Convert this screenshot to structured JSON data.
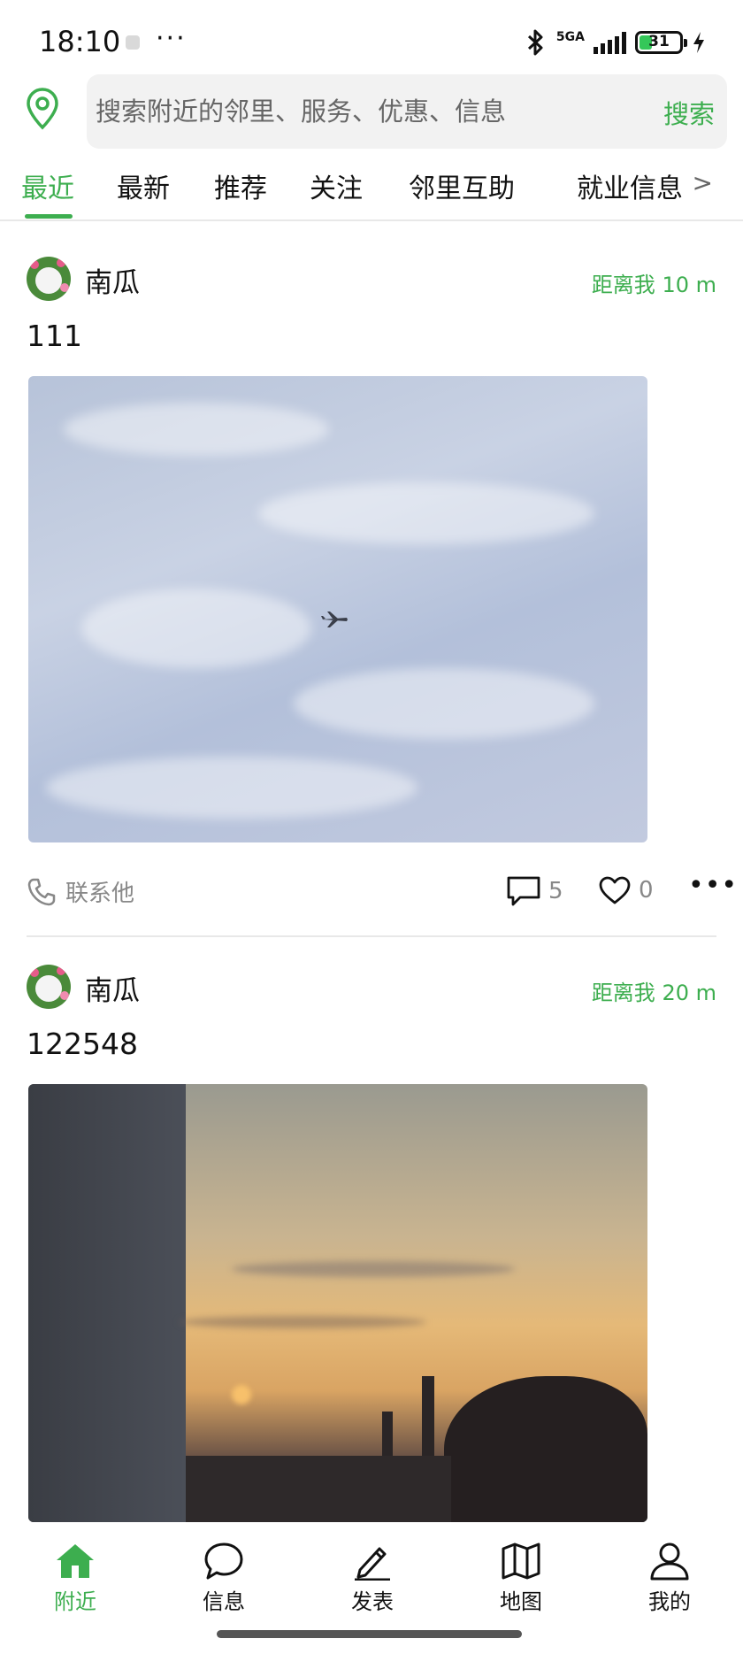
{
  "status_bar": {
    "time": "18:10",
    "more": "···",
    "signal_label": "5GA",
    "battery_level": "31",
    "icons": [
      "bluetooth-icon",
      "signal-icon",
      "battery-icon",
      "charging-icon"
    ]
  },
  "search": {
    "placeholder": "搜索附近的邻里、服务、优惠、信息",
    "button_label": "搜索",
    "location_icon": "location-pin-icon"
  },
  "tabs": {
    "items": [
      "最近",
      "最新",
      "推荐",
      "关注",
      "邻里互助",
      "就业信息"
    ],
    "active_index": 0,
    "more_label": ">"
  },
  "posts": [
    {
      "username": "南瓜",
      "distance": "距离我 10 m",
      "text": "111",
      "image": "sky-with-airplane",
      "contact_label": "联系他",
      "comment_count": "5",
      "like_count": "0"
    },
    {
      "username": "南瓜",
      "distance": "距离我 20 m",
      "text": "122548",
      "image": "city-sunset"
    }
  ],
  "bottom_nav": {
    "items": [
      {
        "label": "附近",
        "icon": "home-icon",
        "active": true
      },
      {
        "label": "信息",
        "icon": "chat-bubble-icon",
        "active": false
      },
      {
        "label": "发表",
        "icon": "pencil-icon",
        "active": false
      },
      {
        "label": "地图",
        "icon": "map-icon",
        "active": false
      },
      {
        "label": "我的",
        "icon": "user-icon",
        "active": false
      }
    ]
  },
  "colors": {
    "accent": "#3dae4f",
    "text": "#111111",
    "muted": "#888888",
    "search_bg": "#f2f2f2"
  }
}
